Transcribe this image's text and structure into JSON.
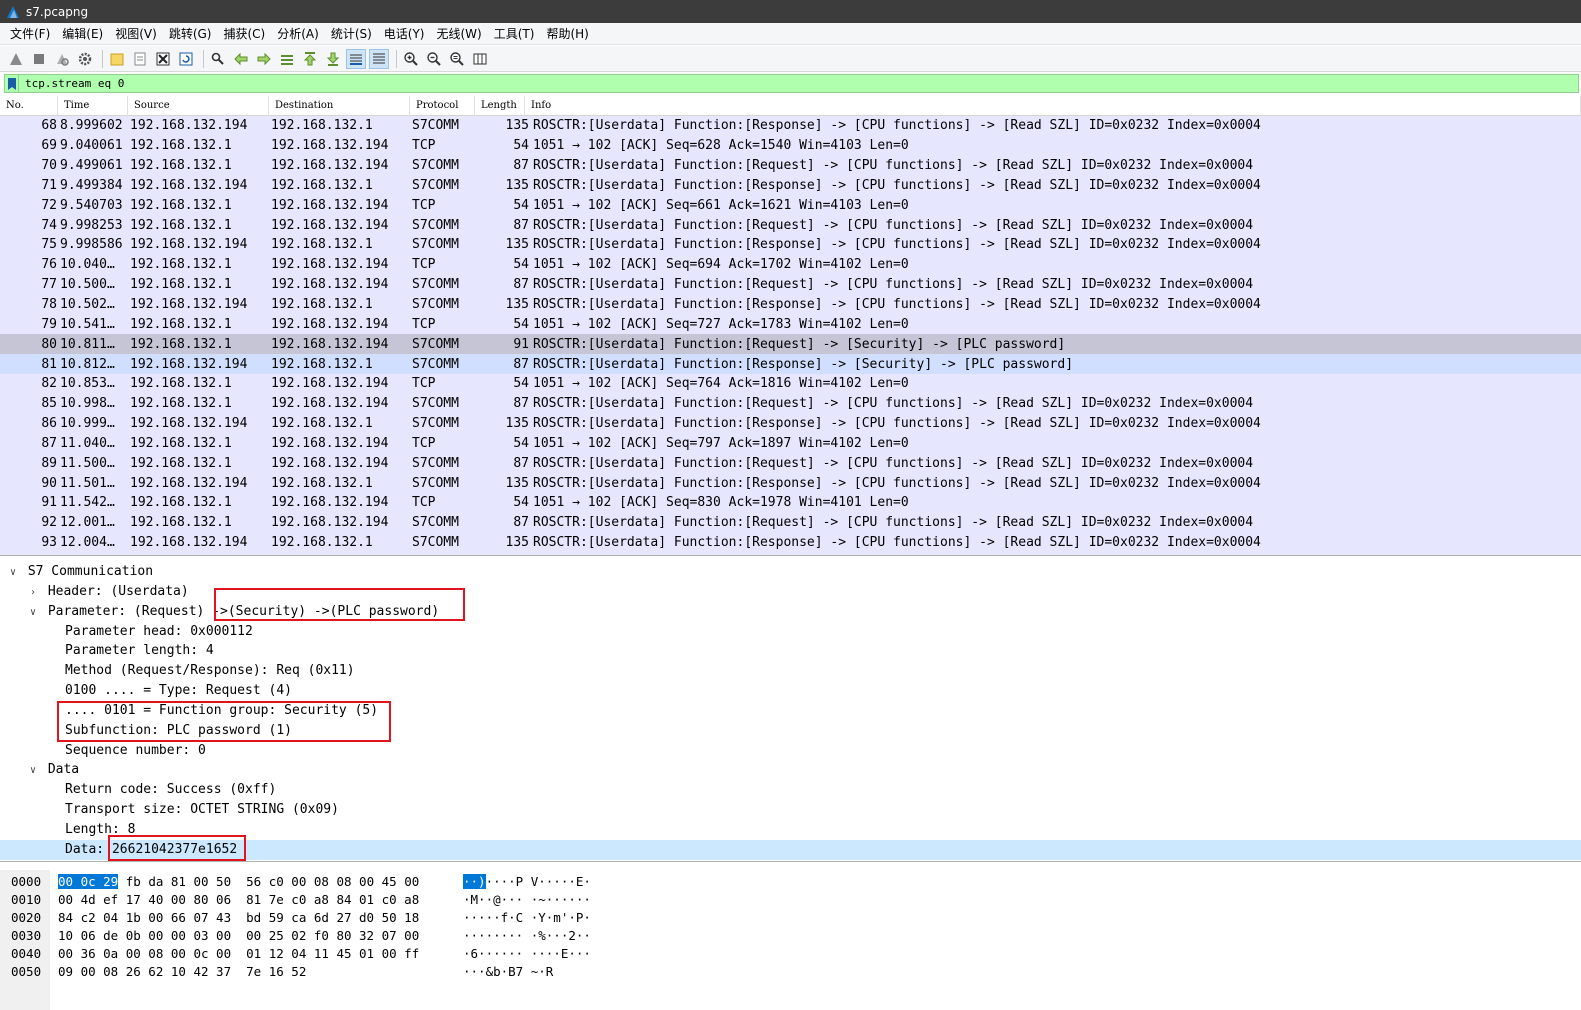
{
  "window": {
    "title": "s7.pcapng"
  },
  "menu": [
    "文件(F)",
    "编辑(E)",
    "视图(V)",
    "跳转(G)",
    "捕获(C)",
    "分析(A)",
    "统计(S)",
    "电话(Y)",
    "无线(W)",
    "工具(T)",
    "帮助(H)"
  ],
  "toolbar": {
    "icons": [
      "shark-fin-start-icon",
      "stop-icon",
      "restart-icon",
      "options-gear-icon",
      "open-folder-icon",
      "open-recent-icon",
      "close-file-icon",
      "reload-icon",
      "find-icon",
      "go-back-icon",
      "go-forward-icon",
      "go-to-packet-icon",
      "first-packet-icon",
      "last-packet-icon",
      "autoscroll-icon",
      "colorize-icon",
      "zoom-in-icon",
      "zoom-out-icon",
      "zoom-normal-icon",
      "resize-columns-icon"
    ]
  },
  "filter": {
    "value": "tcp.stream eq 0"
  },
  "packet_list": {
    "columns": [
      "No.",
      "Time",
      "Source",
      "Destination",
      "Protocol",
      "Length",
      "Info"
    ],
    "rows": [
      {
        "no": "68",
        "time": "8.999602",
        "src": "192.168.132.194",
        "dst": "192.168.132.1",
        "proto": "S7COMM",
        "len": "135",
        "info": "ROSCTR:[Userdata] Function:[Response] -> [CPU functions] -> [Read SZL] ID=0x0232 Index=0x0004"
      },
      {
        "no": "69",
        "time": "9.040061",
        "src": "192.168.132.1",
        "dst": "192.168.132.194",
        "proto": "TCP",
        "len": "54",
        "info": "1051 → 102 [ACK] Seq=628 Ack=1540 Win=4103 Len=0"
      },
      {
        "no": "70",
        "time": "9.499061",
        "src": "192.168.132.1",
        "dst": "192.168.132.194",
        "proto": "S7COMM",
        "len": "87",
        "info": "ROSCTR:[Userdata] Function:[Request] -> [CPU functions] -> [Read SZL] ID=0x0232 Index=0x0004"
      },
      {
        "no": "71",
        "time": "9.499384",
        "src": "192.168.132.194",
        "dst": "192.168.132.1",
        "proto": "S7COMM",
        "len": "135",
        "info": "ROSCTR:[Userdata] Function:[Response] -> [CPU functions] -> [Read SZL] ID=0x0232 Index=0x0004"
      },
      {
        "no": "72",
        "time": "9.540703",
        "src": "192.168.132.1",
        "dst": "192.168.132.194",
        "proto": "TCP",
        "len": "54",
        "info": "1051 → 102 [ACK] Seq=661 Ack=1621 Win=4103 Len=0"
      },
      {
        "no": "74",
        "time": "9.998253",
        "src": "192.168.132.1",
        "dst": "192.168.132.194",
        "proto": "S7COMM",
        "len": "87",
        "info": "ROSCTR:[Userdata] Function:[Request] -> [CPU functions] -> [Read SZL] ID=0x0232 Index=0x0004"
      },
      {
        "no": "75",
        "time": "9.998586",
        "src": "192.168.132.194",
        "dst": "192.168.132.1",
        "proto": "S7COMM",
        "len": "135",
        "info": "ROSCTR:[Userdata] Function:[Response] -> [CPU functions] -> [Read SZL] ID=0x0232 Index=0x0004"
      },
      {
        "no": "76",
        "time": "10.040…",
        "src": "192.168.132.1",
        "dst": "192.168.132.194",
        "proto": "TCP",
        "len": "54",
        "info": "1051 → 102 [ACK] Seq=694 Ack=1702 Win=4102 Len=0"
      },
      {
        "no": "77",
        "time": "10.500…",
        "src": "192.168.132.1",
        "dst": "192.168.132.194",
        "proto": "S7COMM",
        "len": "87",
        "info": "ROSCTR:[Userdata] Function:[Request] -> [CPU functions] -> [Read SZL] ID=0x0232 Index=0x0004"
      },
      {
        "no": "78",
        "time": "10.502…",
        "src": "192.168.132.194",
        "dst": "192.168.132.1",
        "proto": "S7COMM",
        "len": "135",
        "info": "ROSCTR:[Userdata] Function:[Response] -> [CPU functions] -> [Read SZL] ID=0x0232 Index=0x0004"
      },
      {
        "no": "79",
        "time": "10.541…",
        "src": "192.168.132.1",
        "dst": "192.168.132.194",
        "proto": "TCP",
        "len": "54",
        "info": "1051 → 102 [ACK] Seq=727 Ack=1783 Win=4102 Len=0"
      },
      {
        "no": "80",
        "time": "10.811…",
        "src": "192.168.132.1",
        "dst": "192.168.132.194",
        "proto": "S7COMM",
        "len": "91",
        "info": "ROSCTR:[Userdata] Function:[Request] -> [Security] -> [PLC password]"
      },
      {
        "no": "81",
        "time": "10.812…",
        "src": "192.168.132.194",
        "dst": "192.168.132.1",
        "proto": "S7COMM",
        "len": "87",
        "info": "ROSCTR:[Userdata] Function:[Response] -> [Security] -> [PLC password]"
      },
      {
        "no": "82",
        "time": "10.853…",
        "src": "192.168.132.1",
        "dst": "192.168.132.194",
        "proto": "TCP",
        "len": "54",
        "info": "1051 → 102 [ACK] Seq=764 Ack=1816 Win=4102 Len=0"
      },
      {
        "no": "85",
        "time": "10.998…",
        "src": "192.168.132.1",
        "dst": "192.168.132.194",
        "proto": "S7COMM",
        "len": "87",
        "info": "ROSCTR:[Userdata] Function:[Request] -> [CPU functions] -> [Read SZL] ID=0x0232 Index=0x0004"
      },
      {
        "no": "86",
        "time": "10.999…",
        "src": "192.168.132.194",
        "dst": "192.168.132.1",
        "proto": "S7COMM",
        "len": "135",
        "info": "ROSCTR:[Userdata] Function:[Response] -> [CPU functions] -> [Read SZL] ID=0x0232 Index=0x0004"
      },
      {
        "no": "87",
        "time": "11.040…",
        "src": "192.168.132.1",
        "dst": "192.168.132.194",
        "proto": "TCP",
        "len": "54",
        "info": "1051 → 102 [ACK] Seq=797 Ack=1897 Win=4102 Len=0"
      },
      {
        "no": "89",
        "time": "11.500…",
        "src": "192.168.132.1",
        "dst": "192.168.132.194",
        "proto": "S7COMM",
        "len": "87",
        "info": "ROSCTR:[Userdata] Function:[Request] -> [CPU functions] -> [Read SZL] ID=0x0232 Index=0x0004"
      },
      {
        "no": "90",
        "time": "11.501…",
        "src": "192.168.132.194",
        "dst": "192.168.132.1",
        "proto": "S7COMM",
        "len": "135",
        "info": "ROSCTR:[Userdata] Function:[Response] -> [CPU functions] -> [Read SZL] ID=0x0232 Index=0x0004"
      },
      {
        "no": "91",
        "time": "11.542…",
        "src": "192.168.132.1",
        "dst": "192.168.132.194",
        "proto": "TCP",
        "len": "54",
        "info": "1051 → 102 [ACK] Seq=830 Ack=1978 Win=4101 Len=0"
      },
      {
        "no": "92",
        "time": "12.001…",
        "src": "192.168.132.1",
        "dst": "192.168.132.194",
        "proto": "S7COMM",
        "len": "87",
        "info": "ROSCTR:[Userdata] Function:[Request] -> [CPU functions] -> [Read SZL] ID=0x0232 Index=0x0004"
      },
      {
        "no": "93",
        "time": "12.004…",
        "src": "192.168.132.194",
        "dst": "192.168.132.1",
        "proto": "S7COMM",
        "len": "135",
        "info": "ROSCTR:[Userdata] Function:[Response] -> [CPU functions] -> [Read SZL] ID=0x0232 Index=0x0004"
      }
    ]
  },
  "details": {
    "s7": "S7 Communication",
    "header": "Header: (Userdata)",
    "parameter": "Parameter: (Request) ->(Security) ->(PLC password)",
    "param_head": "Parameter head: 0x000112",
    "param_len": "Parameter length: 4",
    "method": "Method (Request/Response): Req (0x11)",
    "type": "0100 .... = Type: Request (4)",
    "func_group": ".... 0101 = Function group: Security (5)",
    "subfunc": "Subfunction: PLC password (1)",
    "seq": "Sequence number: 0",
    "data": "Data",
    "ret_code": "Return code: Success (0xff)",
    "transport": "Transport size: OCTET STRING (0x09)",
    "length": "Length: 8",
    "data_label": "Data: ",
    "data_value": "26621042377e1652"
  },
  "hex": {
    "rows": [
      {
        "off": "0000",
        "hl": "00 0c 29",
        "bytes": " fb da 81 00 50  56 c0 00 08 08 00 45 00",
        "ascii_hl": "··)",
        "ascii": "····P V·····E·"
      },
      {
        "off": "0010",
        "hl": "",
        "bytes": "00 4d ef 17 40 00 80 06  81 7e c0 a8 84 01 c0 a8",
        "ascii_hl": "",
        "ascii": "·M··@··· ·~······"
      },
      {
        "off": "0020",
        "hl": "",
        "bytes": "84 c2 04 1b 00 66 07 43  bd 59 ca 6d 27 d0 50 18",
        "ascii_hl": "",
        "ascii": "·····f·C ·Y·m'·P·"
      },
      {
        "off": "0030",
        "hl": "",
        "bytes": "10 06 de 0b 00 00 03 00  00 25 02 f0 80 32 07 00",
        "ascii_hl": "",
        "ascii": "········ ·%···2··"
      },
      {
        "off": "0040",
        "hl": "",
        "bytes": "00 36 0a 00 08 00 0c 00  01 12 04 11 45 01 00 ff",
        "ascii_hl": "",
        "ascii": "·6······ ····E···"
      },
      {
        "off": "0050",
        "hl": "",
        "bytes": "09 00 08 26 62 10 42 37  7e 16 52",
        "ascii_hl": "",
        "ascii": "···&b·B7 ~·R"
      }
    ]
  },
  "colors": {
    "tcp_row": "#e7e6ff",
    "selected_row": "#c6c5d6",
    "related_row": "#d0deff",
    "filter_bg": "#afffaf",
    "annotation": "#e0141e"
  }
}
